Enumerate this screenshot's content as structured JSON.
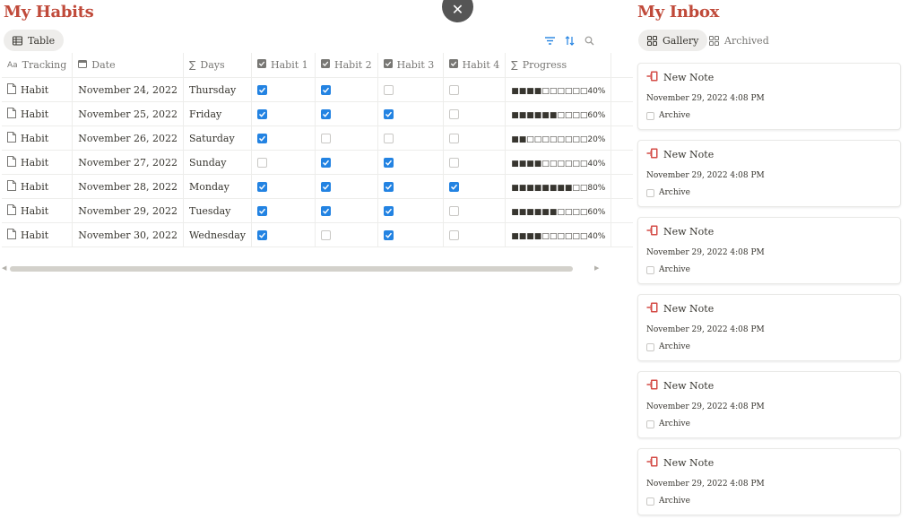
{
  "habits": {
    "title": "My Habits",
    "view_tab": "Table",
    "columns": [
      "Tracking",
      "Date",
      "Days",
      "Habit 1",
      "Habit 2",
      "Habit 3",
      "Habit 4",
      "Progress"
    ],
    "rows": [
      {
        "name": "Habit",
        "date": "November 24, 2022",
        "day": "Thursday",
        "h1": true,
        "h2": true,
        "h3": false,
        "h4": false,
        "bar": "■■■■□□□□□□",
        "pct": "40%"
      },
      {
        "name": "Habit",
        "date": "November 25, 2022",
        "day": "Friday",
        "h1": true,
        "h2": true,
        "h3": true,
        "h4": false,
        "bar": "■■■■■■□□□□",
        "pct": "60%"
      },
      {
        "name": "Habit",
        "date": "November 26, 2022",
        "day": "Saturday",
        "h1": true,
        "h2": false,
        "h3": false,
        "h4": false,
        "bar": "■■□□□□□□□□",
        "pct": "20%"
      },
      {
        "name": "Habit",
        "date": "November 27, 2022",
        "day": "Sunday",
        "h1": false,
        "h2": true,
        "h3": true,
        "h4": false,
        "bar": "■■■■□□□□□□",
        "pct": "40%"
      },
      {
        "name": "Habit",
        "date": "November 28, 2022",
        "day": "Monday",
        "h1": true,
        "h2": true,
        "h3": true,
        "h4": true,
        "bar": "■■■■■■■■□□",
        "pct": "80%"
      },
      {
        "name": "Habit",
        "date": "November 29, 2022",
        "day": "Tuesday",
        "h1": true,
        "h2": true,
        "h3": true,
        "h4": false,
        "bar": "■■■■■■□□□□",
        "pct": "60%"
      },
      {
        "name": "Habit",
        "date": "November 30, 2022",
        "day": "Wednesday",
        "h1": true,
        "h2": false,
        "h3": true,
        "h4": false,
        "bar": "■■■■□□□□□□",
        "pct": "40%"
      }
    ]
  },
  "inbox": {
    "title": "My Inbox",
    "tabs": [
      "Gallery",
      "Archived"
    ],
    "cards": [
      {
        "title": "New Note",
        "date": "November 29, 2022 4:08 PM",
        "archive_label": "Archive"
      },
      {
        "title": "New Note",
        "date": "November 29, 2022 4:08 PM",
        "archive_label": "Archive"
      },
      {
        "title": "New Note",
        "date": "November 29, 2022 4:08 PM",
        "archive_label": "Archive"
      },
      {
        "title": "New Note",
        "date": "November 29, 2022 4:08 PM",
        "archive_label": "Archive"
      },
      {
        "title": "New Note",
        "date": "November 29, 2022 4:08 PM",
        "archive_label": "Archive"
      },
      {
        "title": "New Note",
        "date": "November 29, 2022 4:08 PM",
        "archive_label": "Archive"
      }
    ]
  },
  "overlay": {
    "close_glyph": "✕"
  },
  "colors": {
    "accent": "#c04a3a",
    "checkbox": "#2383e2",
    "icon_red": "#d44c47"
  }
}
